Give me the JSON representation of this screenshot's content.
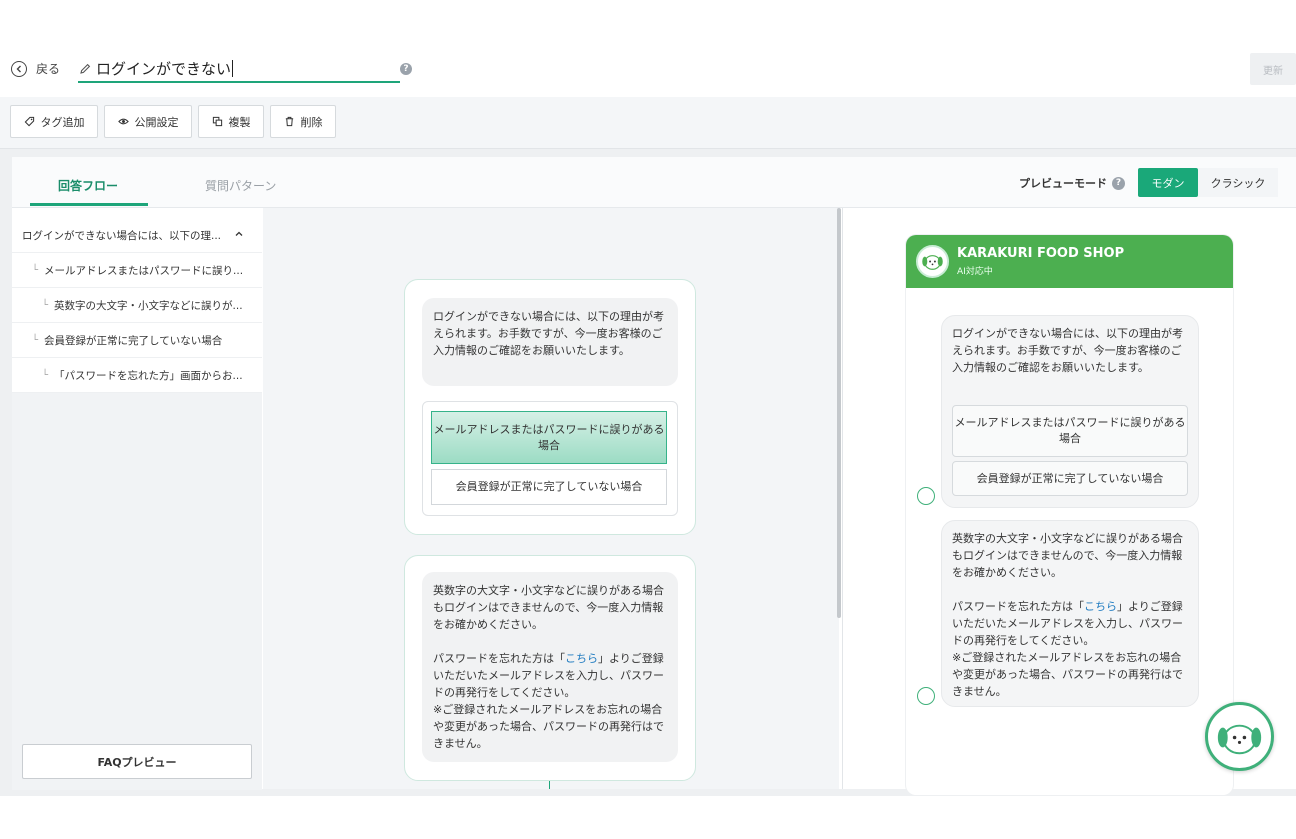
{
  "header": {
    "back_label": "戻る",
    "title": "ログインができない",
    "help": "?",
    "update_label": "更新"
  },
  "toolbar": {
    "add_tag": "タグ追加",
    "publish": "公開設定",
    "duplicate": "複製",
    "delete": "削除"
  },
  "tabs": {
    "flow": "回答フロー",
    "patterns": "質問パターン"
  },
  "preview_mode": {
    "label": "プレビューモード",
    "help": "?",
    "modern": "モダン",
    "classic": "クラシック"
  },
  "tree": {
    "items": [
      {
        "label": "ログインができない場合には、以下の理..."
      },
      {
        "label": "メールアドレスまたはパスワードに誤り..."
      },
      {
        "label": "英数字の大文字・小文字などに誤りが..."
      },
      {
        "label": "会員登録が正常に完了していない場合"
      },
      {
        "label": "「パスワードを忘れた方」画面からお..."
      }
    ],
    "branch_mark": "└",
    "faq_button": "FAQプレビュー"
  },
  "flow": {
    "node1_text": "ログインができない場合には、以下の理由が考えられます。お手数ですが、今一度お客様のご入力情報のご確認をお願いいたします。",
    "option1": "メールアドレスまたはパスワードに誤りがある場合",
    "option2": "会員登録が正常に完了していない場合",
    "node2_p1": "英数字の大文字・小文字などに誤りがある場合もログインはできませんので、今一度入力情報をお確かめください。",
    "node2_p2_before": "パスワードを忘れた方は「",
    "node2_link": "こちら",
    "node2_p2_after": "」よりご登録いただいたメールアドレスを入力し、パスワードの再発行をしてください。",
    "node2_p3": "※ご登録されたメールアドレスをお忘れの場合や変更があった場合、パスワードの再発行はできません。"
  },
  "preview": {
    "shop_name": "KARAKURI FOOD SHOP",
    "status": "AI対応中",
    "msg1": "ログインができない場合には、以下の理由が考えられます。お手数ですが、今一度お客様のご入力情報のご確認をお願いいたします。",
    "opt1": "メールアドレスまたはパスワードに誤りがある場合",
    "opt2": "会員登録が正常に完了していない場合",
    "msg2_p1": "英数字の大文字・小文字などに誤りがある場合もログインはできませんので、今一度入力情報をお確かめください。",
    "msg2_p2_before": "パスワードを忘れた方は「",
    "msg2_link": "こちら",
    "msg2_p2_after": "」よりご登録いただいたメールアドレスを入力し、パスワードの再発行をしてください。",
    "msg2_p3": "※ご登録されたメールアドレスをお忘れの場合や変更があった場合、パスワードの再発行はできません。"
  },
  "colors": {
    "accent": "#1ea57a",
    "header_green": "#4caf50",
    "link": "#1f7bc0"
  }
}
